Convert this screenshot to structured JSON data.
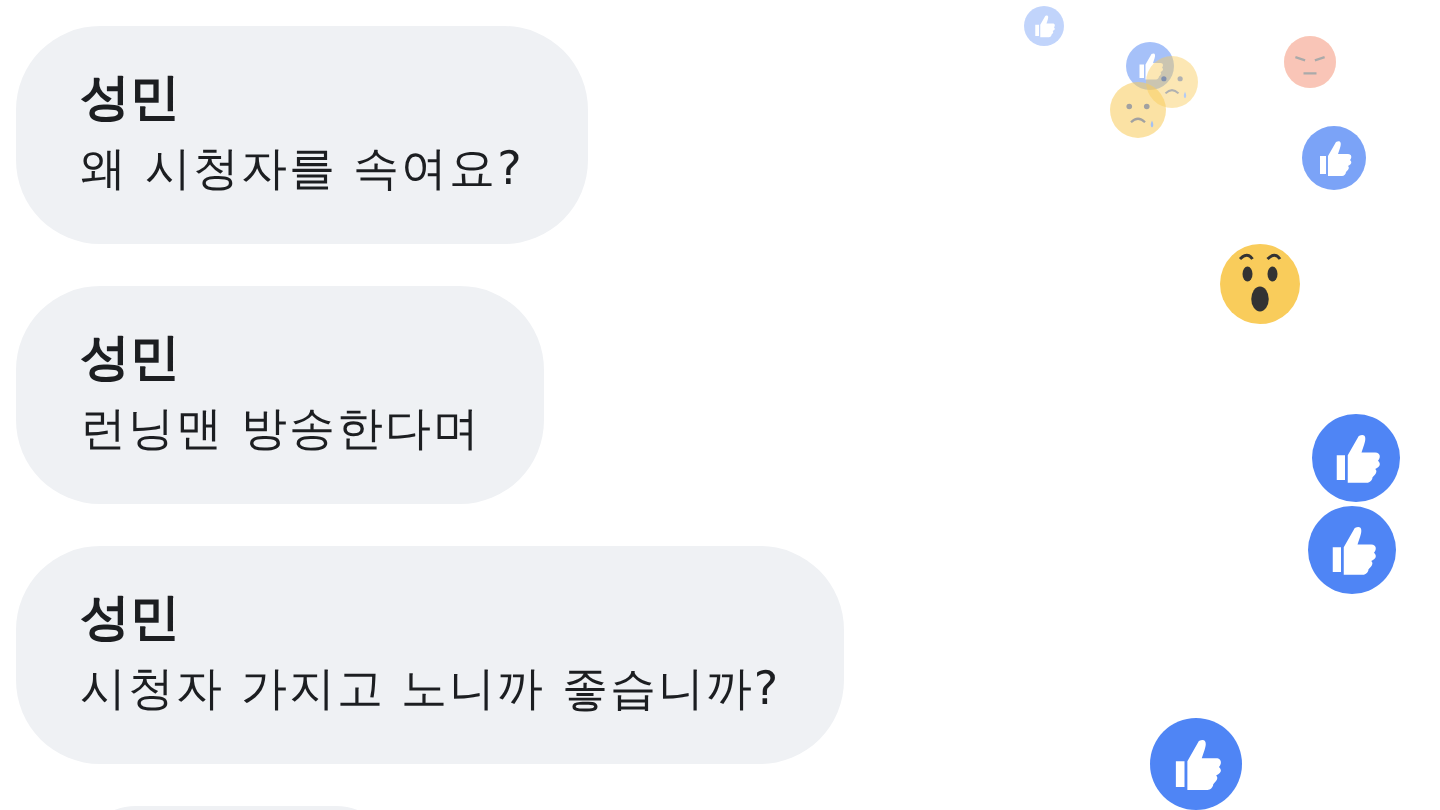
{
  "comments": [
    {
      "author": "성민",
      "message": "왜 시청자를 속여요?"
    },
    {
      "author": "성민",
      "message": "런닝맨 방송한다며"
    },
    {
      "author": "성민",
      "message": "시청자 가지고 노니까 좋습니까?"
    }
  ],
  "partial_comment_visible": true
}
